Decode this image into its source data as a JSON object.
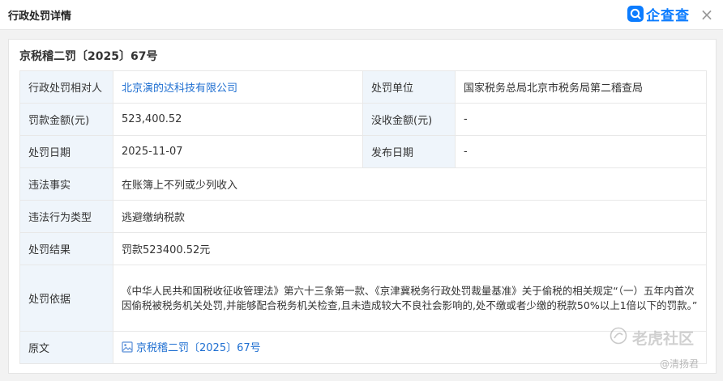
{
  "window": {
    "title": "行政处罚详情",
    "brand_name": "企查查",
    "close_glyph": "×"
  },
  "document_number": "京税稽二罚〔2025〕67号",
  "rows": [
    {
      "k1": "行政处罚相对人",
      "v1": "北京演的达科技有限公司",
      "k2": "处罚单位",
      "v2": "国家税务总局北京市税务局第二稽查局"
    },
    {
      "k1": "罚款金额(元)",
      "v1": "523,400.52",
      "k2": "没收金额(元)",
      "v2": "-"
    },
    {
      "k1": "处罚日期",
      "v1": "2025-11-07",
      "k2": "发布日期",
      "v2": "-"
    }
  ],
  "fact_label": "违法事实",
  "fact_value": "在账簿上不列或少列收入",
  "type_label": "违法行为类型",
  "type_value": "逃避缴纳税款",
  "result_label": "处罚结果",
  "result_value": "罚款523400.52元",
  "basis_label": "处罚依据",
  "basis_value": "《中华人民共和国税收征收管理法》第六十三条第一款、《京津冀税务行政处罚裁量基准》关于偷税的相关规定“（一）五年内首次因偷税被税务机关处罚,并能够配合税务机关检查,且未造成较大不良社会影响的,处不缴或者少缴的税款50%以上1倍以下的罚款。”",
  "original_label": "原文",
  "original_link": "京税稽二罚〔2025〕67号",
  "watermark": "老虎社区",
  "watermark_user": "@清扬君",
  "colors": {
    "brand": "#0b7cff",
    "link": "#1f6fd1",
    "key_bg": "#eff5fb"
  }
}
